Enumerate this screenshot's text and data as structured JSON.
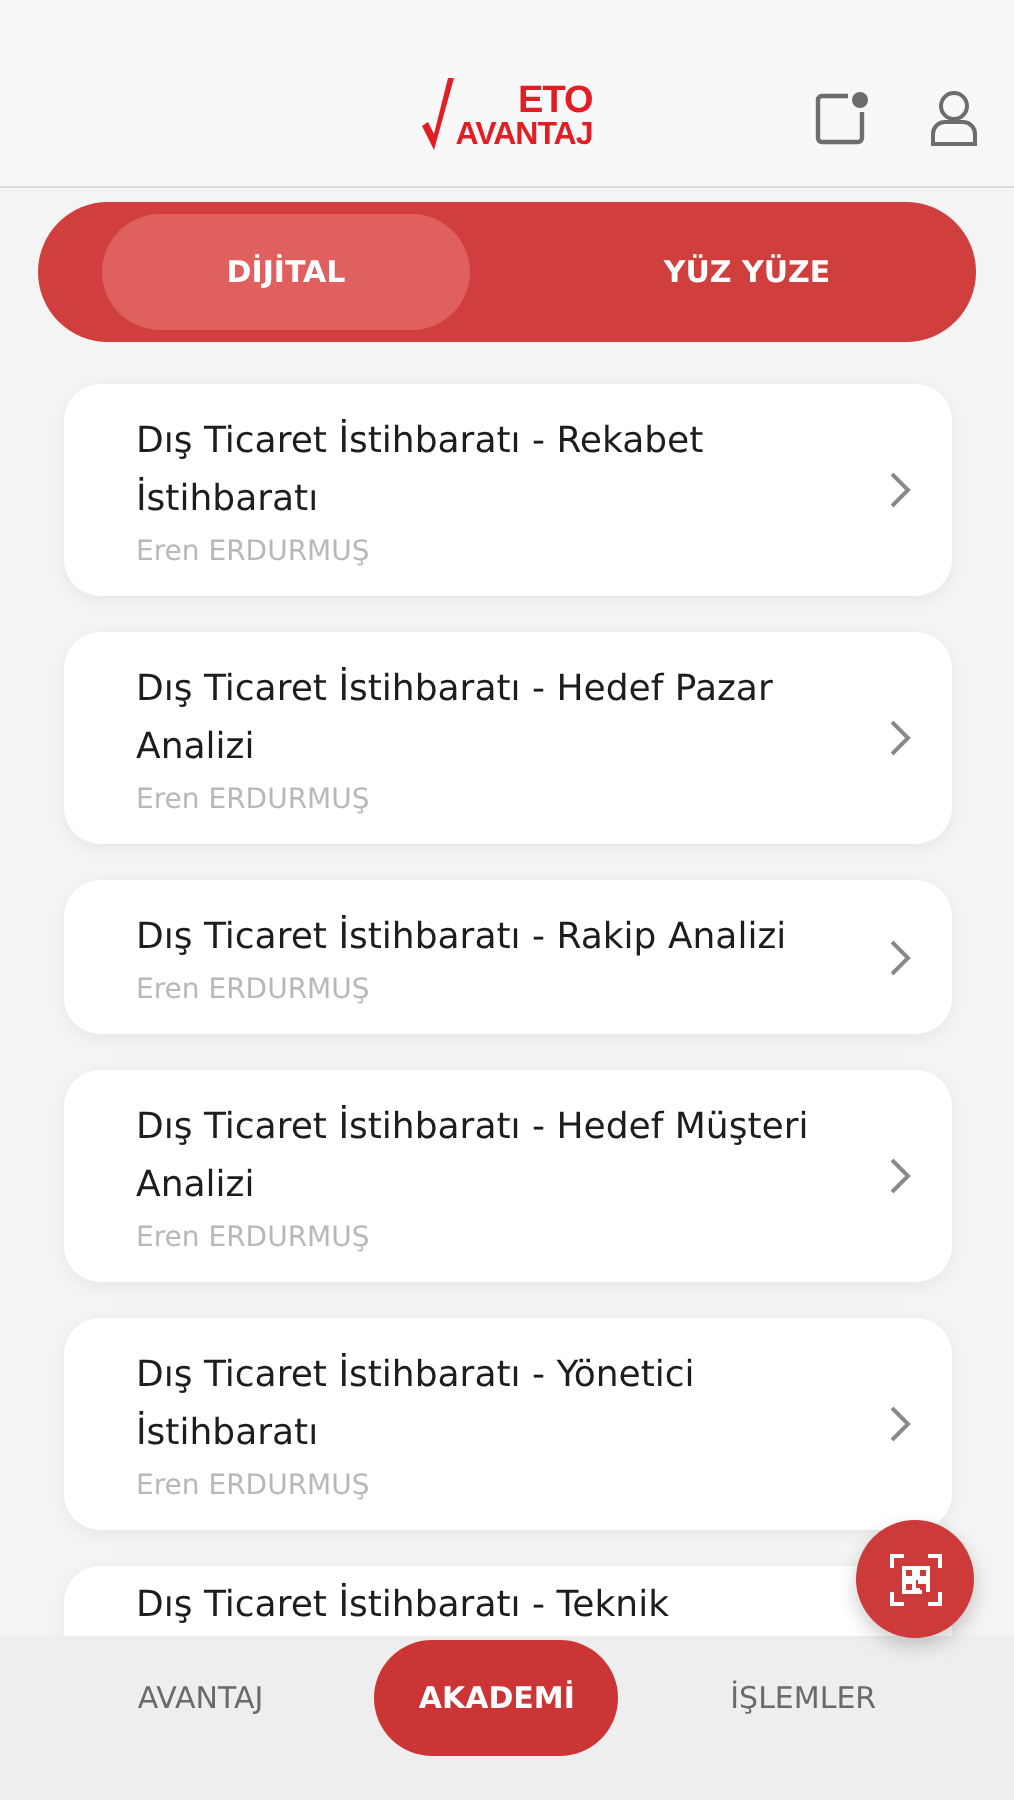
{
  "header": {
    "logo_top": "ETO",
    "logo_bottom": "AVANTAJ",
    "notification_dot": true
  },
  "segments": [
    {
      "label": "DİJİTAL",
      "selected": true
    },
    {
      "label": "YÜZ YÜZE",
      "selected": false
    }
  ],
  "courses": [
    {
      "title": "Dış Ticaret İstihbaratı - Rekabet İstihbaratı",
      "instructor": "Eren ERDURMUŞ"
    },
    {
      "title": "Dış Ticaret İstihbaratı - Hedef Pazar Analizi",
      "instructor": "Eren ERDURMUŞ"
    },
    {
      "title": "Dış Ticaret İstihbaratı - Rakip Analizi",
      "instructor": "Eren ERDURMUŞ"
    },
    {
      "title": "Dış Ticaret İstihbaratı - Hedef Müşteri Analizi",
      "instructor": "Eren ERDURMUŞ"
    },
    {
      "title": "Dış Ticaret İstihbaratı - Yönetici İstihbaratı",
      "instructor": "Eren ERDURMUŞ"
    },
    {
      "title": "Dış Ticaret İstihbaratı - Teknik"
    }
  ],
  "bottom_nav": [
    {
      "label": "AVANTAJ",
      "selected": false
    },
    {
      "label": "AKADEMİ",
      "selected": true
    },
    {
      "label": "İŞLEMLER",
      "selected": false
    }
  ]
}
